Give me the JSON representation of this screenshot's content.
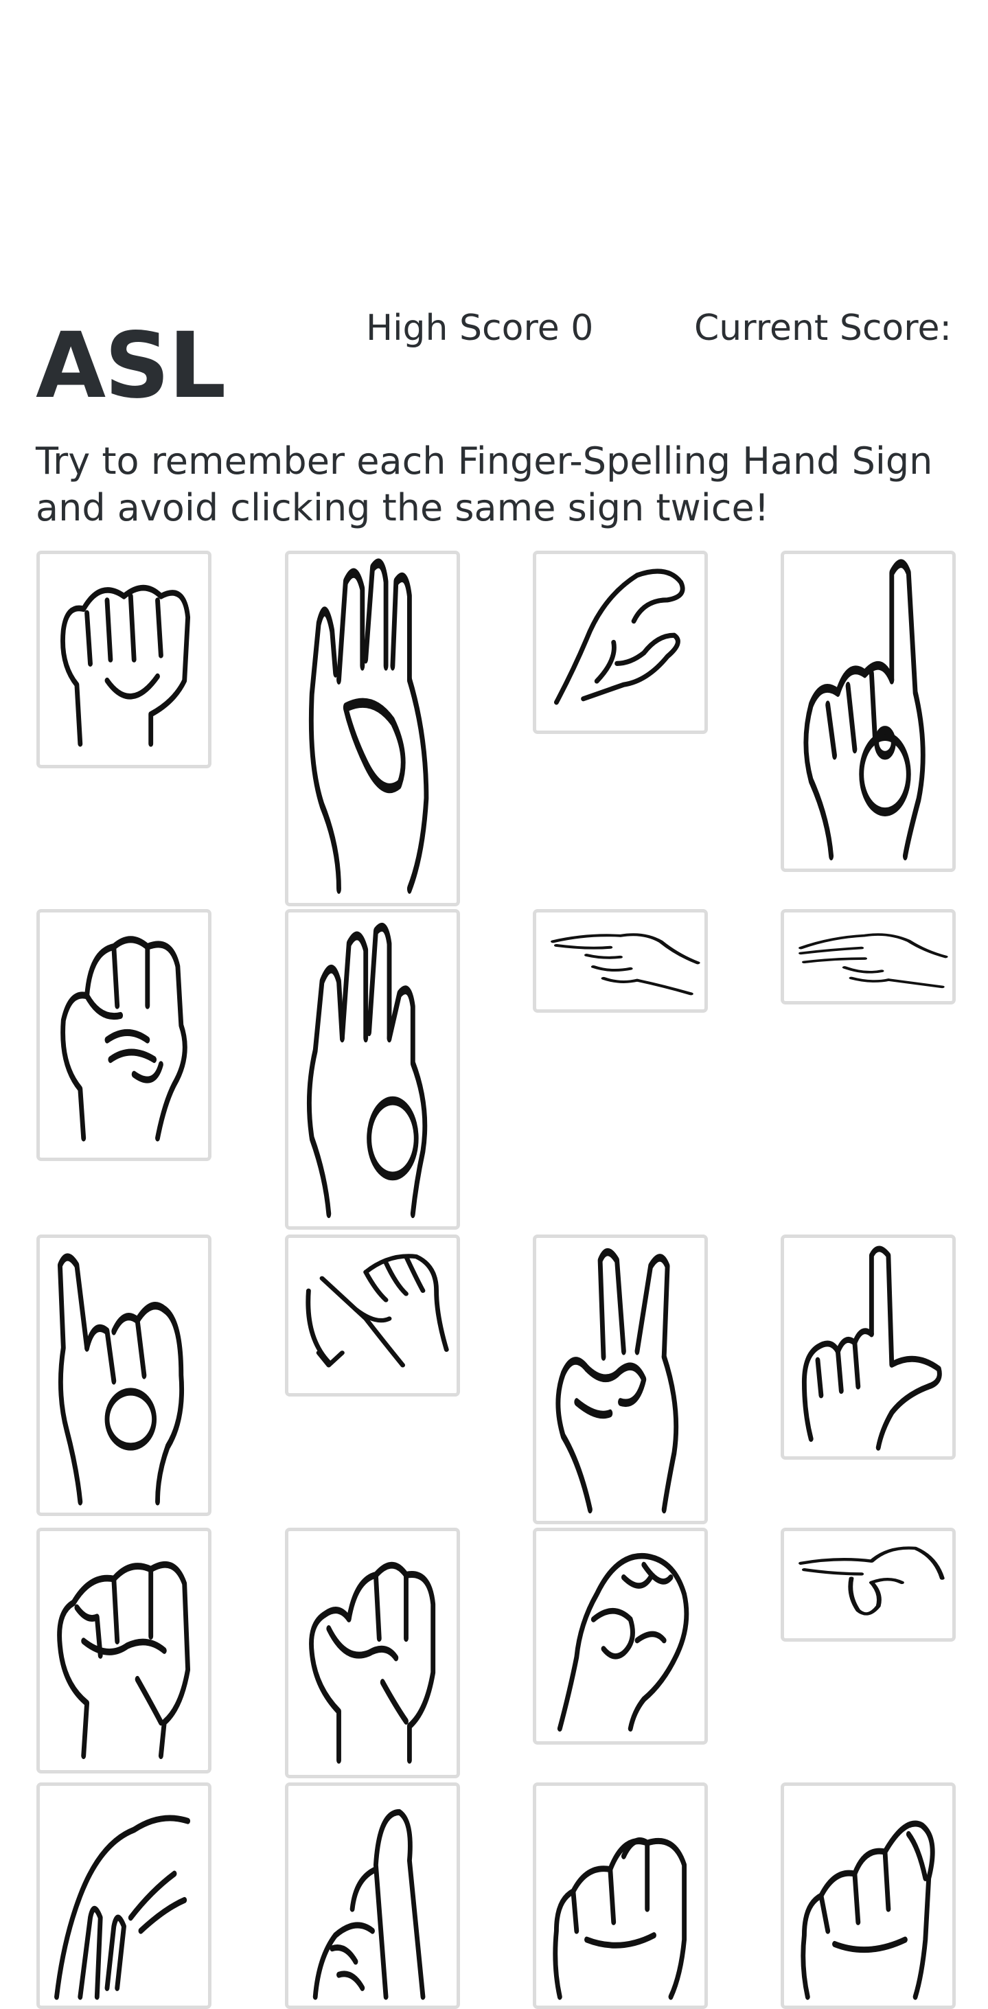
{
  "header": {
    "title": "ASL",
    "high_score_label": "High Score",
    "high_score": "0",
    "current_score_label": "Current Score:"
  },
  "instructions": "Try to remember each Finger-Spelling Hand Sign and avoid clicking the same sign twice!",
  "cards": [
    {
      "name": "card-sign-a",
      "icon": "fist-thumb-side-hand-sign-icon"
    },
    {
      "name": "card-sign-b",
      "icon": "flat-hand-fingers-up-hand-sign-icon"
    },
    {
      "name": "card-sign-c",
      "icon": "curved-c-hand-sign-icon"
    },
    {
      "name": "card-sign-d",
      "icon": "index-up-circle-hand-sign-icon"
    },
    {
      "name": "card-sign-e",
      "icon": "curled-fingers-fist-hand-sign-icon"
    },
    {
      "name": "card-sign-f",
      "icon": "three-fingers-up-circle-hand-sign-icon"
    },
    {
      "name": "card-sign-g",
      "icon": "pointing-sideways-hand-sign-icon"
    },
    {
      "name": "card-sign-h",
      "icon": "two-fingers-sideways-hand-sign-icon"
    },
    {
      "name": "card-sign-i",
      "icon": "pinky-up-hand-sign-icon"
    },
    {
      "name": "card-sign-j",
      "icon": "pinky-hook-motion-hand-sign-icon"
    },
    {
      "name": "card-sign-k",
      "icon": "two-fingers-up-thumb-between-hand-sign-icon"
    },
    {
      "name": "card-sign-l",
      "icon": "l-shape-hand-sign-icon"
    },
    {
      "name": "card-sign-m",
      "icon": "thumb-under-three-fingers-hand-sign-icon"
    },
    {
      "name": "card-sign-n",
      "icon": "thumb-under-two-fingers-hand-sign-icon"
    },
    {
      "name": "card-sign-o",
      "icon": "o-shape-hand-sign-icon"
    },
    {
      "name": "card-sign-p",
      "icon": "pointing-down-sideways-hand-sign-icon"
    },
    {
      "name": "card-sign-q",
      "icon": "pointing-down-hand-sign-icon"
    },
    {
      "name": "card-sign-r",
      "icon": "crossed-fingers-hand-sign-icon"
    },
    {
      "name": "card-sign-s",
      "icon": "fist-thumb-front-hand-sign-icon"
    },
    {
      "name": "card-sign-t",
      "icon": "thumb-between-fingers-fist-hand-sign-icon"
    }
  ]
}
